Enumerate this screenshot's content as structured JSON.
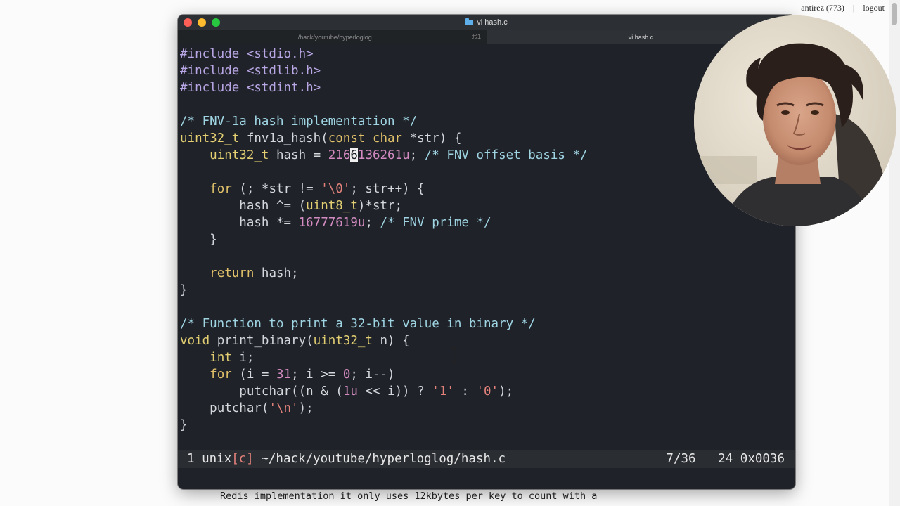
{
  "site_header": {
    "user": "antirez (773)",
    "separator": "|",
    "logout": "logout"
  },
  "terminal": {
    "title": "vi hash.c",
    "tabs": [
      {
        "label": ".../hack/youtube/hyperloglog",
        "shortcut": "⌘1"
      },
      {
        "label": "vi hash.c"
      }
    ]
  },
  "code": {
    "l01": "#include <stdio.h>",
    "l02": "#include <stdlib.h>",
    "l03": "#include <stdint.h>",
    "l05": "/* FNV-1a hash implementation */",
    "l06_kw": "const char",
    "l06_ty": "uint32_t",
    "l06_fn": " fnv1a_hash(",
    "l06_tail": " *str) {",
    "l07_indent": "    ",
    "l07_ty": "uint32_t",
    "l07_a": " hash = ",
    "l07_num_a": "216",
    "l07_cursor": "6",
    "l07_num_b": "136261u",
    "l07_b": "; ",
    "l07_cm": "/* FNV offset basis */",
    "l09_kw": "for",
    "l09_a": " (; *str != ",
    "l09_str": "'\\0'",
    "l09_b": "; str++) {",
    "l10_a": "hash ^= (",
    "l10_ty": "uint8_t",
    "l10_b": ")*str;",
    "l11_a": "hash *= ",
    "l11_num": "16777619u",
    "l11_b": "; ",
    "l11_cm": "/* FNV prime */",
    "l12": "}",
    "l14_kw": "return",
    "l14_a": " hash;",
    "l15": "}",
    "l17": "/* Function to print a 32-bit value in binary */",
    "l18_kw": "void",
    "l18_a": " print_binary(",
    "l18_ty": "uint32_t",
    "l18_b": " n) {",
    "l19_kw": "int",
    "l19_a": " i;",
    "l20_kw": "for",
    "l20_a": " (i = ",
    "l20_n1": "31",
    "l20_b": "; i >= ",
    "l20_n2": "0",
    "l20_c": "; i--)",
    "l21_a": "putchar((n & (",
    "l21_n": "1u",
    "l21_b": " << i)) ? ",
    "l21_s1": "'1'",
    "l21_c": " : ",
    "l21_s2": "'0'",
    "l21_d": ");",
    "l22_a": "putchar(",
    "l22_s": "'\\n'",
    "l22_b": ");",
    "l23": "}"
  },
  "statusline": {
    "buffer": "1 unix",
    "filetype": "[c]",
    "path": " ~/hack/youtube/hyperloglog/hash.c",
    "position": "7/36",
    "column": "24 0x0036"
  },
  "background_text": "Redis implementation it only uses 12kbytes per key to count with a",
  "colors": {
    "editor_bg": "#1f2329",
    "preprocessor": "#b9a6e4",
    "type": "#e3cf72",
    "number": "#d48bc1",
    "string": "#e3817b",
    "comment": "#9fd4e3"
  }
}
